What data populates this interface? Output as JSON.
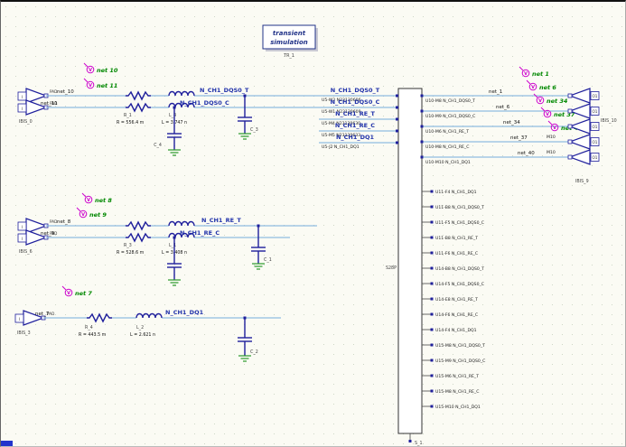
{
  "title_block": {
    "line1": "transient",
    "line2": "simulation",
    "ref": "TR_1"
  },
  "icons": {
    "probe_glyph": "V"
  },
  "colors": {
    "wire": "#76aedd",
    "symbol": "#1f1f9c",
    "net_label": "#008800",
    "probe": "#cc00cc",
    "signal_text": "#2233aa",
    "ground": "#2a9a2a"
  },
  "group_dqs0": {
    "buffer_ref": "IBIS_0",
    "pin_label": "I",
    "pad_label": "PAD",
    "probe1": "net 10",
    "probe2": "net 11",
    "wire1": "net_10",
    "wire2": "net_11",
    "signal1": "N_CH1_DQS0_T",
    "signal2": "N_CH1_DQS0_C",
    "r_ref": "R_1",
    "r_value": "R = 556.4 m",
    "l_ref": "L_4",
    "l_value": "L = 3.747 n",
    "cap1_ref": "C_4",
    "cap2_ref": "C_3"
  },
  "group_re": {
    "buffer_ref": "IBIS_6",
    "pin_label": "I",
    "pad_label": "PAD",
    "probe1": "net 8",
    "probe2": "net 9",
    "wire1": "net_8",
    "wire2": "net_9",
    "signal1": "N_CH1_RE_T",
    "signal2": "N_CH1_RE_C",
    "r_ref": "R_3",
    "r_value": "R = 528.6 m",
    "l_ref": "L_1",
    "l_value": "L = 3.408 n",
    "cap_ref": "C_1"
  },
  "group_dq1": {
    "buffer_ref": "IBIS_3",
    "pin_label": "I",
    "pad_label": "PAD",
    "probe1": "net 7",
    "wire1": "net_7",
    "signal1": "N_CH1_DQ1",
    "r_ref": "R_4",
    "r_value": "R = 443.5 m",
    "l_ref": "L_2",
    "l_value": "L = 2.621 n",
    "cap_ref": "C_2"
  },
  "connector": {
    "ref": "S28P",
    "bottom_ref": "S_1",
    "left_rows": [
      {
        "signal": "N_CH1_DQS0_T",
        "pin": "U5-W2 N23130606"
      },
      {
        "signal": "N_CH1_DQS0_C",
        "pin": "U5-W1 N23130609"
      },
      {
        "signal": "N_CH1_RE_T",
        "pin": "U5-M4 N23130630"
      },
      {
        "signal": "N_CH1_RE_C",
        "pin": "U5-M5 N23130633"
      },
      {
        "signal": "N_CH1_DQ1",
        "pin": "U5-J2 N_CH1_DQ1"
      }
    ],
    "right_wired_rows": [
      {
        "pin": "U10-M8 N_CH1_DQS0_T",
        "wire": "net_1",
        "probe": "net 1"
      },
      {
        "pin": "U10-M9 N_CH1_DQS0_C",
        "wire": "net_6",
        "probe": "net 6"
      },
      {
        "pin": "U10-M6 N_CH1_RE_T",
        "wire": "net_34",
        "probe": "net 34"
      },
      {
        "pin": "U10-M8 N_CH1_RE_C",
        "wire": "net_37",
        "probe": "net 37"
      },
      {
        "pin": "U10-M10 N_CH1_DQ1",
        "wire": "net_40",
        "probe": "net 40"
      }
    ],
    "right_stub_rows": [
      "U11-F4 N_CH1_DQ1",
      "U11-B8 N_CH1_DQS0_T",
      "U11-F5 N_CH1_DQS0_C",
      "U11-B8 N_CH1_RE_T",
      "U11-F6 N_CH1_RE_C",
      "U14-B8 N_CH1_DQS0_T",
      "U14-F5 N_CH1_DQS0_C",
      "U14-E8 N_CH1_RE_T",
      "U14-F6 N_CH1_RE_C",
      "U14-F4 N_CH1_DQ1",
      "U15-M8 N_CH1_DQS0_T",
      "U15-M9 N_CH1_DQS0_C",
      "U15-M6 N_CH1_RE_T",
      "U15-M8 N_CH1_RE_C",
      "U15-M10 N_CH1_DQ1"
    ]
  },
  "right_buffers": {
    "group_ref": "IBIS_9",
    "ref2": "IBIS_10",
    "pin_label": "O1",
    "pad_pin": "M10"
  }
}
